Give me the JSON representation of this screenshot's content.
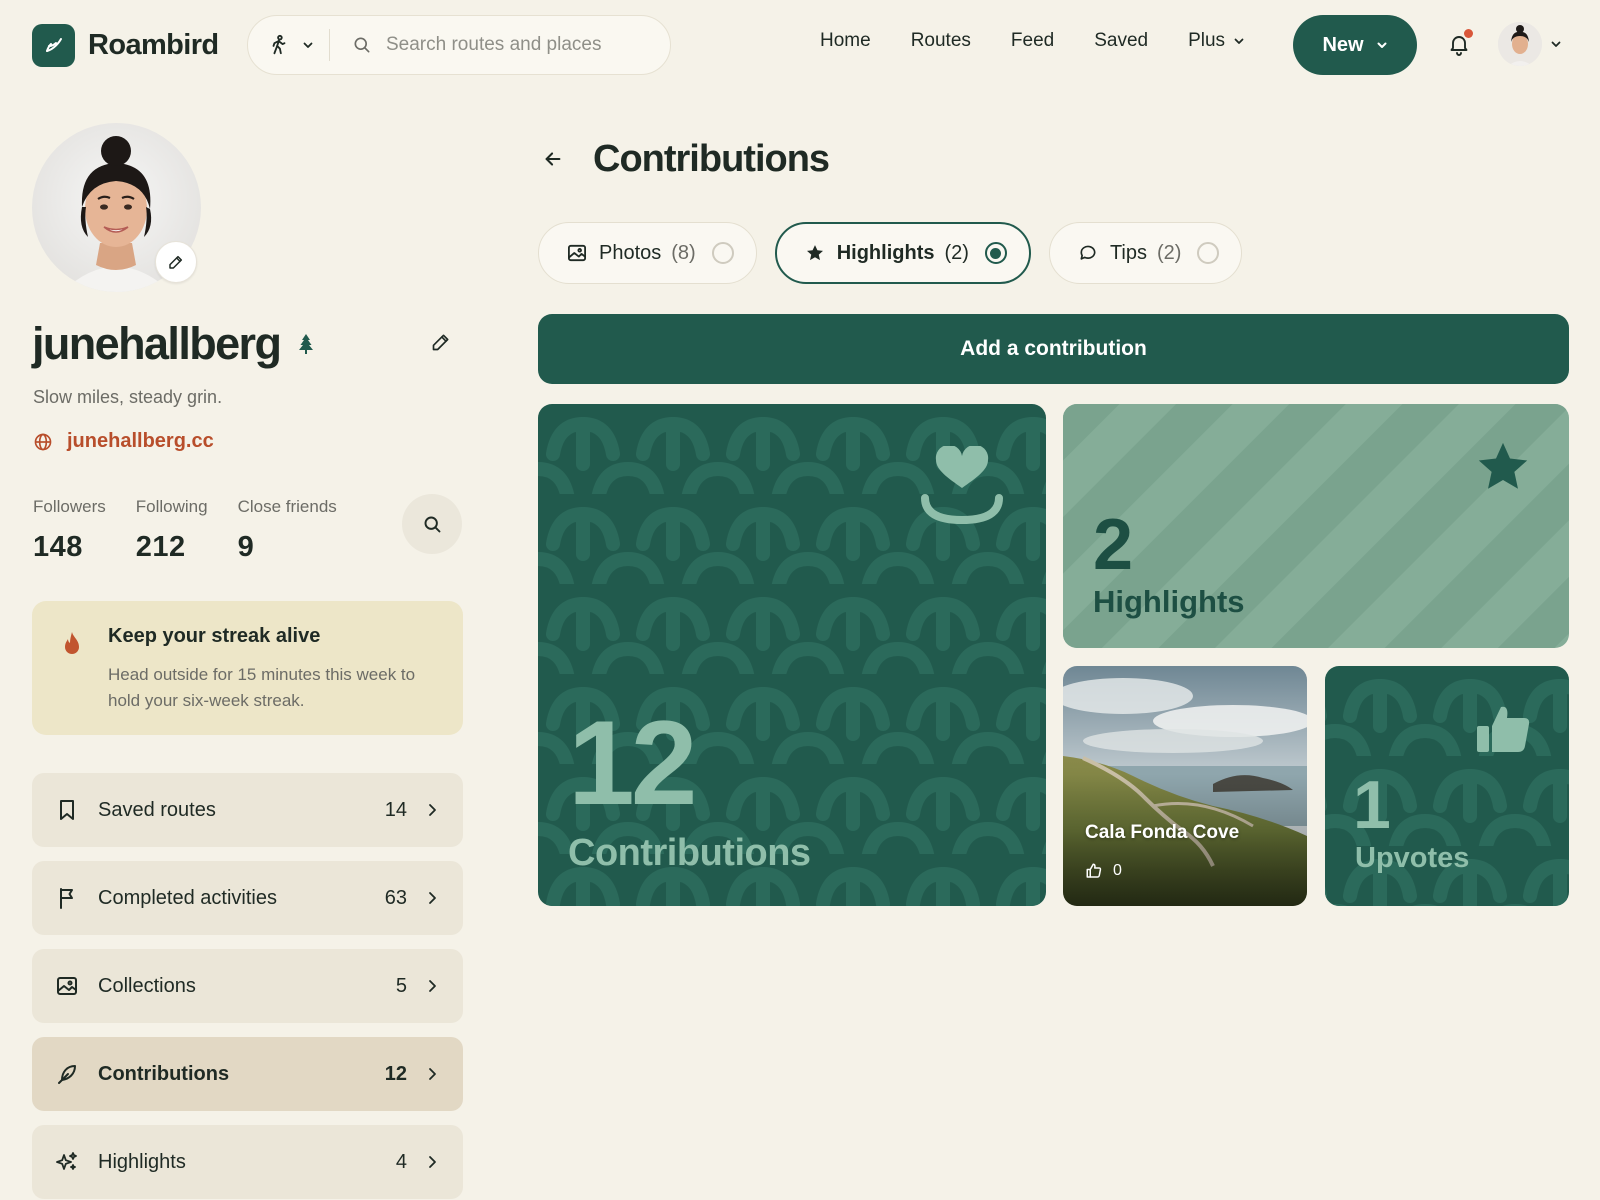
{
  "brand": {
    "name": "Roambird"
  },
  "search": {
    "placeholder": "Search routes and places",
    "activity_icon": "hiker-icon"
  },
  "nav": {
    "items": [
      {
        "label": "Home"
      },
      {
        "label": "Routes"
      },
      {
        "label": "Feed"
      },
      {
        "label": "Saved"
      },
      {
        "label": "Plus",
        "dropdown": true
      }
    ],
    "new_button": "New"
  },
  "notifications": {
    "has_unread": true
  },
  "profile": {
    "username": "junehallberg",
    "badge_icon": "tree-icon",
    "bio": "Slow miles, steady grin.",
    "website": "junehallberg.cc",
    "stats": [
      {
        "label": "Followers",
        "value": "148"
      },
      {
        "label": "Following",
        "value": "212"
      },
      {
        "label": "Close friends",
        "value": "9"
      }
    ]
  },
  "streak": {
    "title": "Keep your streak alive",
    "body": "Head outside for 15 minutes this week to hold your six-week streak."
  },
  "menu": [
    {
      "label": "Saved routes",
      "count": "14",
      "icon": "bookmark-icon",
      "active": false
    },
    {
      "label": "Completed activities",
      "count": "63",
      "icon": "flag-icon",
      "active": false
    },
    {
      "label": "Collections",
      "count": "5",
      "icon": "image-icon",
      "active": false
    },
    {
      "label": "Contributions",
      "count": "12",
      "icon": "feather-icon",
      "active": true
    },
    {
      "label": "Highlights",
      "count": "4",
      "icon": "sparkle-icon",
      "active": false
    }
  ],
  "main": {
    "title": "Contributions",
    "tabs": [
      {
        "label": "Photos",
        "count": "(8)",
        "icon": "image-icon",
        "selected": false
      },
      {
        "label": "Highlights",
        "count": "(2)",
        "icon": "star-icon",
        "selected": true
      },
      {
        "label": "Tips",
        "count": "(2)",
        "icon": "chat-bubble-icon",
        "selected": false
      }
    ],
    "add_button": "Add a contribution",
    "tiles": {
      "contributions": {
        "value": "12",
        "label": "Contributions",
        "icon": "heart-hand-icon"
      },
      "highlights": {
        "value": "2",
        "label": "Highlights",
        "icon": "star-icon"
      },
      "photo": {
        "title": "Cala Fonda Cove",
        "likes": "0"
      },
      "upvotes": {
        "value": "1",
        "label": "Upvotes",
        "icon": "thumbs-up-icon"
      }
    }
  },
  "colors": {
    "background": "#f5f2e8",
    "primary": "#215a4d",
    "accent": "#b84e2b",
    "streak_bg": "#ede6c8",
    "highlight_tile": "#85ad98",
    "notification_dot": "#d9573a"
  }
}
